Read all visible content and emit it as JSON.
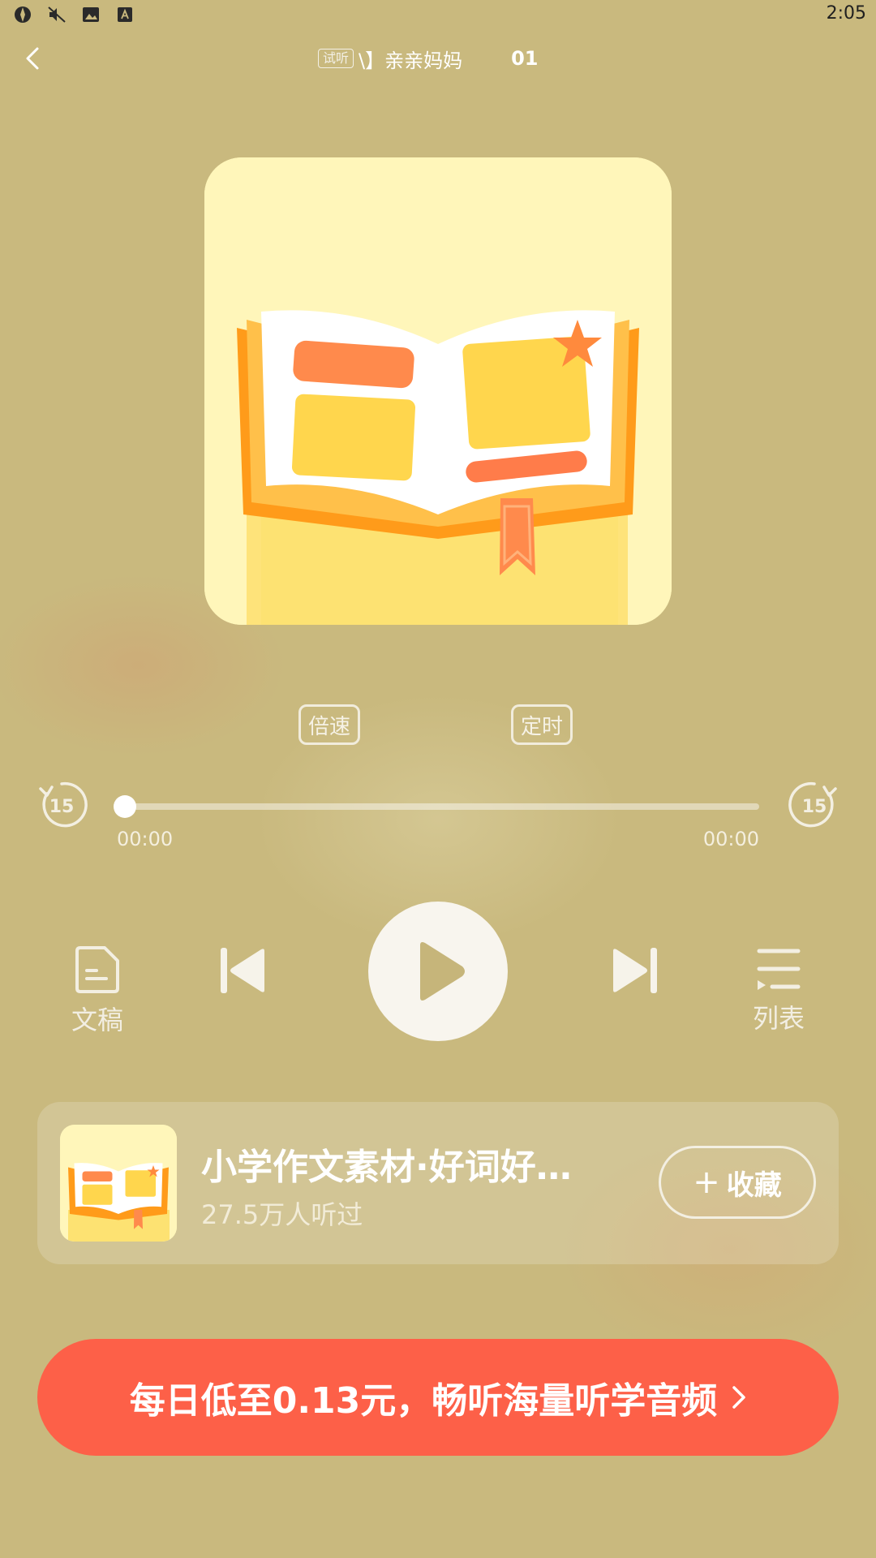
{
  "status_bar": {
    "time": "2:05",
    "icons": [
      "app-icon",
      "mute-icon",
      "image-icon",
      "text-app-icon"
    ]
  },
  "header": {
    "trial_badge": "试听",
    "title": "\\】亲亲妈妈",
    "track_number": "01"
  },
  "player": {
    "speed_label": "倍速",
    "timer_label": "定时",
    "skip_back_seconds": "15",
    "skip_forward_seconds": "15",
    "current_time": "00:00",
    "total_time": "00:00",
    "progress": 0,
    "transcript_label": "文稿",
    "playlist_label": "列表"
  },
  "album": {
    "title": "小学作文素材·好词好…",
    "listens": "27.5万人听过",
    "favorite_label": "收藏",
    "favorite_icon": "+"
  },
  "promo": {
    "text": "每日低至0.13元，畅听海量听学音频"
  },
  "colors": {
    "background": "#c9b97e",
    "promo": "#fd6048",
    "play_button": "#f8f5ee"
  }
}
